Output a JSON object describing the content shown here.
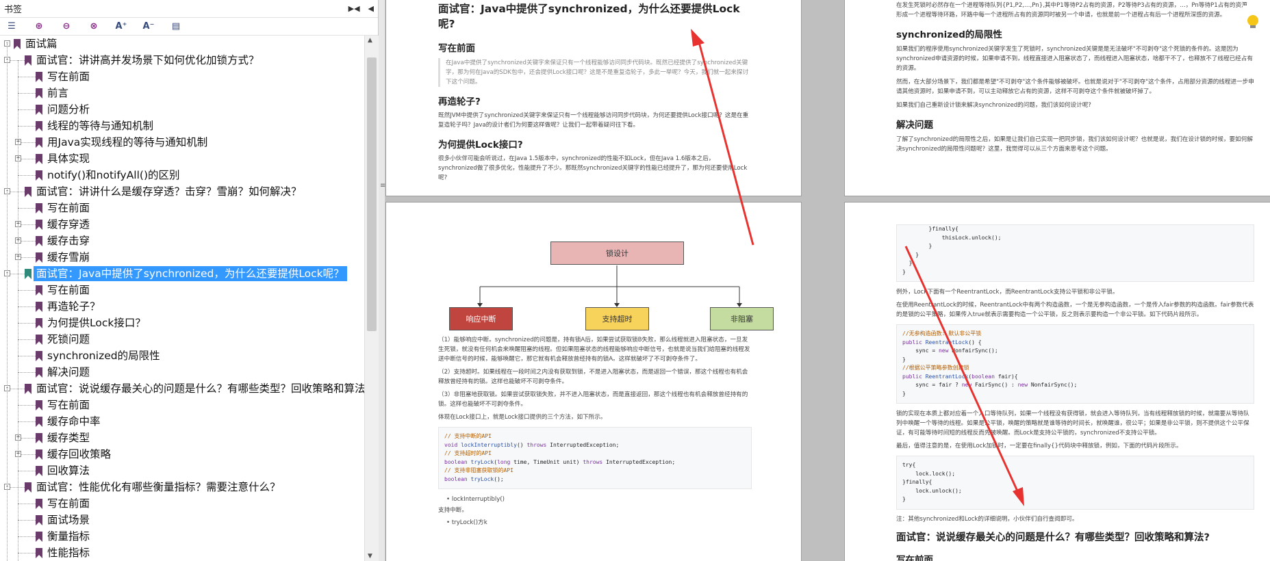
{
  "panel": {
    "title": "书签",
    "toolbar_icons": [
      "bookmark-list-icon",
      "add-bookmark-icon",
      "bookmark-prev-icon",
      "bookmark-next-icon",
      "font-increase-icon",
      "font-decrease-icon",
      "bookmark-properties-icon"
    ],
    "toolbar_glyphs": {
      "font_increase": "A⁺",
      "font_decrease": "A⁻"
    }
  },
  "tree": [
    {
      "level": 0,
      "label": "面试篇",
      "exp": "-",
      "sel": false,
      "color": "#6b3b6b"
    },
    {
      "level": 1,
      "label": "面试官：讲讲高并发场景下如何优化加锁方式？",
      "exp": "-",
      "sel": false,
      "color": "#6b3b6b"
    },
    {
      "level": 2,
      "label": "写在前面",
      "exp": "",
      "sel": false,
      "color": "#6b3b6b"
    },
    {
      "level": 2,
      "label": "前言",
      "exp": "",
      "sel": false,
      "color": "#6b3b6b"
    },
    {
      "level": 2,
      "label": "问题分析",
      "exp": "",
      "sel": false,
      "color": "#6b3b6b"
    },
    {
      "level": 2,
      "label": "线程的等待与通知机制",
      "exp": "",
      "sel": false,
      "color": "#6b3b6b"
    },
    {
      "level": 2,
      "label": "用Java实现线程的等待与通知机制",
      "exp": "+",
      "sel": false,
      "color": "#6b3b6b"
    },
    {
      "level": 2,
      "label": "具体实现",
      "exp": "+",
      "sel": false,
      "color": "#6b3b6b"
    },
    {
      "level": 2,
      "label": "notify()和notifyAll()的区别",
      "exp": "",
      "sel": false,
      "color": "#6b3b6b"
    },
    {
      "level": 1,
      "label": "面试官：讲讲什么是缓存穿透？击穿？雪崩？如何解决？",
      "exp": "-",
      "sel": false,
      "color": "#6b3b6b"
    },
    {
      "level": 2,
      "label": "写在前面",
      "exp": "",
      "sel": false,
      "color": "#6b3b6b"
    },
    {
      "level": 2,
      "label": "缓存穿透",
      "exp": "+",
      "sel": false,
      "color": "#6b3b6b"
    },
    {
      "level": 2,
      "label": "缓存击穿",
      "exp": "+",
      "sel": false,
      "color": "#6b3b6b"
    },
    {
      "level": 2,
      "label": "缓存雪崩",
      "exp": "+",
      "sel": false,
      "color": "#6b3b6b"
    },
    {
      "level": 1,
      "label": "面试官：Java中提供了synchronized，为什么还要提供Lock呢？",
      "exp": "-",
      "sel": true,
      "color": "#2f8a7a"
    },
    {
      "level": 2,
      "label": "写在前面",
      "exp": "",
      "sel": false,
      "color": "#6b3b6b"
    },
    {
      "level": 2,
      "label": "再造轮子？",
      "exp": "",
      "sel": false,
      "color": "#6b3b6b"
    },
    {
      "level": 2,
      "label": "为何提供Lock接口？",
      "exp": "",
      "sel": false,
      "color": "#6b3b6b"
    },
    {
      "level": 2,
      "label": "死锁问题",
      "exp": "",
      "sel": false,
      "color": "#6b3b6b"
    },
    {
      "level": 2,
      "label": "synchronized的局限性",
      "exp": "",
      "sel": false,
      "color": "#6b3b6b"
    },
    {
      "level": 2,
      "label": "解决问题",
      "exp": "",
      "sel": false,
      "color": "#6b3b6b"
    },
    {
      "level": 1,
      "label": "面试官：说说缓存最关心的问题是什么？有哪些类型？回收策略和算法？",
      "exp": "-",
      "sel": false,
      "color": "#6b3b6b"
    },
    {
      "level": 2,
      "label": "写在前面",
      "exp": "",
      "sel": false,
      "color": "#6b3b6b"
    },
    {
      "level": 2,
      "label": "缓存命中率",
      "exp": "",
      "sel": false,
      "color": "#6b3b6b"
    },
    {
      "level": 2,
      "label": "缓存类型",
      "exp": "+",
      "sel": false,
      "color": "#6b3b6b"
    },
    {
      "level": 2,
      "label": "缓存回收策略",
      "exp": "+",
      "sel": false,
      "color": "#6b3b6b"
    },
    {
      "level": 2,
      "label": "回收算法",
      "exp": "",
      "sel": false,
      "color": "#6b3b6b"
    },
    {
      "level": 1,
      "label": "面试官：性能优化有哪些衡量指标？需要注意什么？",
      "exp": "-",
      "sel": false,
      "color": "#6b3b6b"
    },
    {
      "level": 2,
      "label": "写在前面",
      "exp": "",
      "sel": false,
      "color": "#6b3b6b"
    },
    {
      "level": 2,
      "label": "面试场景",
      "exp": "",
      "sel": false,
      "color": "#6b3b6b"
    },
    {
      "level": 2,
      "label": "衡量指标",
      "exp": "",
      "sel": false,
      "color": "#6b3b6b"
    },
    {
      "level": 2,
      "label": "性能指标",
      "exp": "",
      "sel": false,
      "color": "#6b3b6b"
    }
  ],
  "page1": {
    "title": "面试官：Java中提供了synchronized，为什么还要提供Lock呢?",
    "h_front": "写在前面",
    "quote": "在Java中提供了synchronized关键字来保证只有一个线程能够访问同步代码块。既然已经提供了synchronized关键字，那为何在Java的SDK包中，还会提供Lock接口呢？这是不是重复造轮子，多此一举呢？今天，我们就一起来探讨下这个问题。",
    "h_wheel": "再造轮子?",
    "p_wheel": "既然JVM中提供了synchronized关键字来保证只有一个线程能够访问同步代码块，为何还要提供Lock接口呢？这是在重复造轮子吗？Java的设计者们为何要这样做呢？让我们一起带着疑问往下看。",
    "h_why": "为何提供Lock接口?",
    "p_why": "很多小伙伴可能会听说过，在Java 1.5版本中，synchronized的性能不如Lock，但在Java 1.6版本之后，synchronized做了很多优化，性能提升了不少。那既然synchronized关键字的性能已经提升了，那为何还要使用Lock呢?"
  },
  "page2": {
    "p_top": "在发生死锁时必然存在一个进程等待队列{P1,P2,…,Pn},其中P1等待P2占有的资源，P2等待P3占有的资源，…，Pn等待P1占有的资源，形成一个进程等待环路，环路中每一个进程所占有的资源同时被另一个申请，也就是前一个进程占有后一个进程所深感的资源。",
    "h_limit": "synchronized的局限性",
    "p_limit1": "如果我们的程序使用synchronized关键字发生了死锁时，synchronized关键是是无法破坏\"不可剥夺\"这个死锁的条件的。这是因为synchronized申请资源的时候，如果申请不到，线程直接进入阻塞状态了，而线程进入阻塞状态，啥都干不了，也释放不了线程已经占有的资源。",
    "p_limit2": "然而，在大部分场景下，我们都是希望\"不可剥夺\"这个条件能够被破坏。也就是说对于\"不可剥夺\"这个条件，占用部分资源的线程进一步申请其他资源时，如果申请不到，可以主动释放它占有的资源，这样不可剥夺这个条件就被破坏掉了。",
    "p_limit3": "如果我们自己重新设计锁来解决synchronized的问题，我们该如何设计呢?",
    "h_solve": "解决问题",
    "p_solve": "了解了synchronized的局限性之后，如果是让我们自己实现一把同步锁，我们该如何设计呢？也就是说，我们在设计锁的时候，要如何解决synchronized的局限性问题呢？这里，我觉得可以从三个方面来思考这个问题。"
  },
  "page3": {
    "diagram": {
      "root": "锁设计",
      "a": "响应中断",
      "b": "支持超时",
      "c": "非阻塞"
    },
    "p1": "（1）能够响应中断。synchronized的问题是，持有锁A后，如果尝试获取锁B失败，那么线程就进入阻塞状态，一旦发生死锁，就没有任何机会来唤醒阻塞的线程。但如果阻塞状态的线程能够响应中断信号，也就是说当我们给阻塞的线程发送中断信号的时候，能够唤醒它，那它就有机会释放曾经持有的锁A。这样就破坏了不可剥夺条件了。",
    "p2": "（2）支持超时。如果线程在一段时间之内没有获取到锁，不是进入阻塞状态，而是返回一个错误，那这个线程也有机会释放曾经持有的锁。这样也能破坏不可剥夺条件。",
    "p3": "（3）非阻塞地获取锁。如果尝试获取锁失败，并不进入阻塞状态，而是直接返回，那这个线程也有机会释放曾经持有的锁。这样也能破坏不可剥夺条件。",
    "p4": "体现在Lock接口上，就是Lock接口提供的三个方法，如下所示。",
    "code": [
      [
        "cm",
        "// 支持中断的API"
      ],
      [
        "kw",
        "void ",
        "fn",
        "lockInterruptibly",
        "",
        "() ",
        "kw",
        "throws ",
        "",
        "InterruptedException;"
      ],
      [
        "cm",
        "// 支持超时的API"
      ],
      [
        "kw",
        "boolean ",
        "fn",
        "tryLock",
        "",
        "(",
        "kw",
        "long ",
        "",
        "time, TimeUnit unit) ",
        "kw",
        "throws ",
        "",
        "InterruptedException;"
      ],
      [
        "cm",
        "// 支持非阻塞获取锁的API"
      ],
      [
        "kw",
        "boolean ",
        "fn",
        "tryLock",
        "",
        "();"
      ]
    ],
    "li1": "lockInterruptibly()",
    "p5": "支持中断。",
    "li2": "tryLock()方k"
  },
  "page4": {
    "code_top": [
      "        }finally{",
      "            thisLock.unlock();",
      "        }",
      "    }",
      "  }",
      "}"
    ],
    "p1": "例外，Lock下面有一个ReentrantLock，而ReentrantLock支持公平锁和非公平锁。",
    "p2": "在使用ReentrantLock的时候，ReentrantLock中有两个构造函数，一个是无参构造函数，一个是传入fair参数的构造函数。fair参数代表的是锁的公平策略，如果传入true就表示需要构造一个公平锁，反之则表示要构造一个非公平锁。如下代码片段所示。",
    "code_mid": [
      [
        "cm",
        "//无参构造函数: 默认非公平锁"
      ],
      [
        "kw",
        "public ",
        "fn",
        "ReentrantLock",
        "",
        "() {"
      ],
      [
        "",
        "    sync = ",
        "kw",
        "new ",
        "",
        "NonfairSync();"
      ],
      [
        "",
        "}"
      ],
      [
        "cm",
        "//根据公平策略参数创建锁"
      ],
      [
        "kw",
        "public ",
        "fn",
        "ReentrantLock",
        "",
        "(",
        "kw",
        "boolean ",
        "",
        "fair){"
      ],
      [
        "",
        "    sync = fair ? ",
        "kw",
        "new ",
        "",
        "FairSync() : ",
        "kw",
        "new ",
        "",
        "NonfairSync();"
      ],
      [
        "",
        "}"
      ]
    ],
    "p3": "锁的实现在本质上都对应着一个入口等待队列，如果一个线程没有获得锁，就会进入等待队列，当有线程释放锁的时候，就需要从等待队列中唤醒一个等待的线程。如果是公平锁，唤醒的策略就是谁等待的时间长，就唤醒谁，很公平；如果是非公平锁，则不提供这个公平保证，有可能等待时间短的线程反而先被唤醒。而Lock是支持公平锁的，synchronized不支持公平锁。",
    "p4": "最后，值得注意的是，在使用Lock加锁时，一定要在finally{}代码块中释放锁，例如，下面的代码片段所示。",
    "code_bot": [
      "try{",
      "    lock.lock();",
      "}finally{",
      "    lock.unlock();",
      "}"
    ],
    "p5": "注：其他synchronized和Lock的详细说明，小伙伴们自行查阅即可。",
    "title2": "面试官：说说缓存最关心的问题是什么？有哪些类型？回收策略和算法?",
    "h_front": "写在前面"
  },
  "colors": {
    "selection": "#3399ff",
    "arrow": "#e8322f",
    "box_root": "#e8b4b4",
    "box_a": "#c0453f",
    "box_b": "#f7d35c",
    "box_c": "#c4dca0"
  }
}
